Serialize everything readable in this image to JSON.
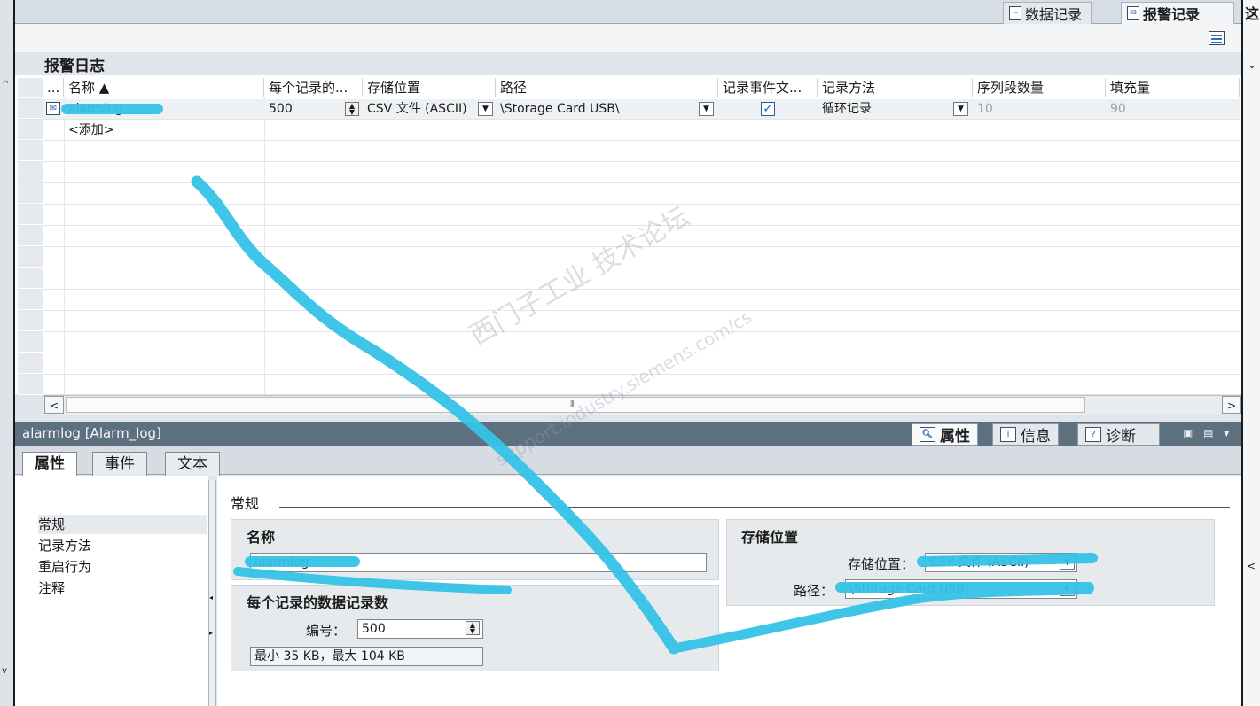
{
  "top_tabs": [
    {
      "label": "数据记录",
      "active": false
    },
    {
      "label": "报警记录",
      "active": true
    },
    {
      "label": "这"
    }
  ],
  "editor": {
    "title": "报警日志"
  },
  "table": {
    "columns": [
      "...",
      "名称 ▲",
      "每个记录的...",
      "存储位置",
      "路径",
      "记录事件文...",
      "记录方法",
      "序列段数量",
      "填充量"
    ],
    "rows": [
      {
        "name": "alarmlog",
        "records": "500",
        "storage": "CSV 文件 (ASCII)",
        "path": "\\Storage Card USB\\",
        "log_event_text": true,
        "method": "循环记录",
        "segments": "10",
        "fill": "90"
      }
    ],
    "add_label": "<添加>"
  },
  "hscroll": {
    "left": "<",
    "right": ">",
    "thumb": "⦀"
  },
  "inspector": {
    "title": "alarmlog [Alarm_log]",
    "tabs": [
      {
        "label": "属性",
        "icon": "properties-icon",
        "active": true
      },
      {
        "label": "信息",
        "icon": "info-icon",
        "active": false
      },
      {
        "label": "诊断",
        "icon": "diagnostics-icon",
        "active": false
      }
    ],
    "controls": "▣ ▤ ▾",
    "subtabs": [
      "属性",
      "事件",
      "文本"
    ],
    "nav": [
      "常规",
      "记录方法",
      "重启行为",
      "注释"
    ],
    "section": "常规",
    "name_group": {
      "title": "名称",
      "value": "alarmlog"
    },
    "records_group": {
      "title": "每个记录的数据记录数",
      "number_label": "编号：",
      "number_value": "500",
      "size_info": "最小 35 KB，最大 104 KB"
    },
    "storage_group": {
      "title": "存储位置",
      "storage_label": "存储位置：",
      "storage_value": "CSV 文件 (ASCII)",
      "path_label": "路径：",
      "path_value": "\\Storage Card USB\\"
    }
  },
  "watermark": {
    "line1": "西门子工业 技术论坛",
    "line2": "support.industry.siemens.com/cs"
  },
  "colors": {
    "highlight_marker": "#35c2e6",
    "inspector_header": "#5d7080",
    "accent_blue": "#1d5fb3"
  }
}
